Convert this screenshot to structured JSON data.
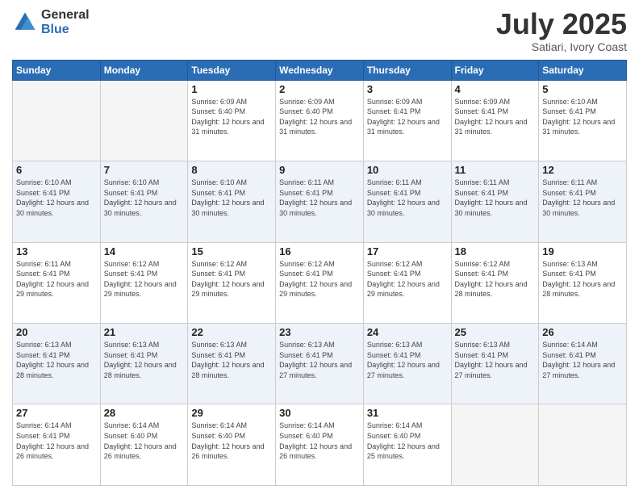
{
  "logo": {
    "general": "General",
    "blue": "Blue"
  },
  "title": {
    "month": "July 2025",
    "location": "Satiari, Ivory Coast"
  },
  "days_of_week": [
    "Sunday",
    "Monday",
    "Tuesday",
    "Wednesday",
    "Thursday",
    "Friday",
    "Saturday"
  ],
  "weeks": [
    [
      {
        "day": "",
        "empty": true
      },
      {
        "day": "",
        "empty": true
      },
      {
        "day": "1",
        "sunrise": "6:09 AM",
        "sunset": "6:40 PM",
        "daylight": "12 hours and 31 minutes."
      },
      {
        "day": "2",
        "sunrise": "6:09 AM",
        "sunset": "6:40 PM",
        "daylight": "12 hours and 31 minutes."
      },
      {
        "day": "3",
        "sunrise": "6:09 AM",
        "sunset": "6:41 PM",
        "daylight": "12 hours and 31 minutes."
      },
      {
        "day": "4",
        "sunrise": "6:09 AM",
        "sunset": "6:41 PM",
        "daylight": "12 hours and 31 minutes."
      },
      {
        "day": "5",
        "sunrise": "6:10 AM",
        "sunset": "6:41 PM",
        "daylight": "12 hours and 31 minutes."
      }
    ],
    [
      {
        "day": "6",
        "sunrise": "6:10 AM",
        "sunset": "6:41 PM",
        "daylight": "12 hours and 30 minutes."
      },
      {
        "day": "7",
        "sunrise": "6:10 AM",
        "sunset": "6:41 PM",
        "daylight": "12 hours and 30 minutes."
      },
      {
        "day": "8",
        "sunrise": "6:10 AM",
        "sunset": "6:41 PM",
        "daylight": "12 hours and 30 minutes."
      },
      {
        "day": "9",
        "sunrise": "6:11 AM",
        "sunset": "6:41 PM",
        "daylight": "12 hours and 30 minutes."
      },
      {
        "day": "10",
        "sunrise": "6:11 AM",
        "sunset": "6:41 PM",
        "daylight": "12 hours and 30 minutes."
      },
      {
        "day": "11",
        "sunrise": "6:11 AM",
        "sunset": "6:41 PM",
        "daylight": "12 hours and 30 minutes."
      },
      {
        "day": "12",
        "sunrise": "6:11 AM",
        "sunset": "6:41 PM",
        "daylight": "12 hours and 30 minutes."
      }
    ],
    [
      {
        "day": "13",
        "sunrise": "6:11 AM",
        "sunset": "6:41 PM",
        "daylight": "12 hours and 29 minutes."
      },
      {
        "day": "14",
        "sunrise": "6:12 AM",
        "sunset": "6:41 PM",
        "daylight": "12 hours and 29 minutes."
      },
      {
        "day": "15",
        "sunrise": "6:12 AM",
        "sunset": "6:41 PM",
        "daylight": "12 hours and 29 minutes."
      },
      {
        "day": "16",
        "sunrise": "6:12 AM",
        "sunset": "6:41 PM",
        "daylight": "12 hours and 29 minutes."
      },
      {
        "day": "17",
        "sunrise": "6:12 AM",
        "sunset": "6:41 PM",
        "daylight": "12 hours and 29 minutes."
      },
      {
        "day": "18",
        "sunrise": "6:12 AM",
        "sunset": "6:41 PM",
        "daylight": "12 hours and 28 minutes."
      },
      {
        "day": "19",
        "sunrise": "6:13 AM",
        "sunset": "6:41 PM",
        "daylight": "12 hours and 28 minutes."
      }
    ],
    [
      {
        "day": "20",
        "sunrise": "6:13 AM",
        "sunset": "6:41 PM",
        "daylight": "12 hours and 28 minutes."
      },
      {
        "day": "21",
        "sunrise": "6:13 AM",
        "sunset": "6:41 PM",
        "daylight": "12 hours and 28 minutes."
      },
      {
        "day": "22",
        "sunrise": "6:13 AM",
        "sunset": "6:41 PM",
        "daylight": "12 hours and 28 minutes."
      },
      {
        "day": "23",
        "sunrise": "6:13 AM",
        "sunset": "6:41 PM",
        "daylight": "12 hours and 27 minutes."
      },
      {
        "day": "24",
        "sunrise": "6:13 AM",
        "sunset": "6:41 PM",
        "daylight": "12 hours and 27 minutes."
      },
      {
        "day": "25",
        "sunrise": "6:13 AM",
        "sunset": "6:41 PM",
        "daylight": "12 hours and 27 minutes."
      },
      {
        "day": "26",
        "sunrise": "6:14 AM",
        "sunset": "6:41 PM",
        "daylight": "12 hours and 27 minutes."
      }
    ],
    [
      {
        "day": "27",
        "sunrise": "6:14 AM",
        "sunset": "6:41 PM",
        "daylight": "12 hours and 26 minutes."
      },
      {
        "day": "28",
        "sunrise": "6:14 AM",
        "sunset": "6:40 PM",
        "daylight": "12 hours and 26 minutes."
      },
      {
        "day": "29",
        "sunrise": "6:14 AM",
        "sunset": "6:40 PM",
        "daylight": "12 hours and 26 minutes."
      },
      {
        "day": "30",
        "sunrise": "6:14 AM",
        "sunset": "6:40 PM",
        "daylight": "12 hours and 26 minutes."
      },
      {
        "day": "31",
        "sunrise": "6:14 AM",
        "sunset": "6:40 PM",
        "daylight": "12 hours and 25 minutes."
      },
      {
        "day": "",
        "empty": true
      },
      {
        "day": "",
        "empty": true
      }
    ]
  ]
}
